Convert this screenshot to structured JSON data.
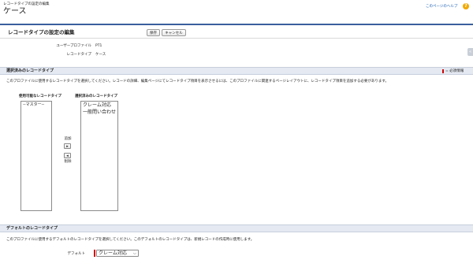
{
  "header": {
    "breadcrumb": "レコードタイプの設定の編集",
    "title": "ケース",
    "help_link": "このページのヘルプ",
    "help_icon": "question-icon"
  },
  "panel": {
    "title": "レコードタイプの設定の編集",
    "save_label": "保存",
    "cancel_label": "キャンセル",
    "profile_label": "ユーザープロファイル",
    "profile_value": "PT1",
    "record_type_label": "レコードタイプ",
    "record_type_value": "ケース"
  },
  "selected_section": {
    "title": "選択済みのレコードタイプ",
    "required_info": "= 必須情報",
    "description": "このプロファイルに使用するレコードタイプを選択してください。レコードの詳細、編集ページにてレコードタイプ項目を表示させるには、このプロファイルに関連するページレイアウトに、レコードタイプ項目を追加する必要があります。",
    "available_label": "使用可能なレコードタイプ",
    "selected_label": "選択済みのレコードタイプ",
    "available_items": [
      "--マスター--"
    ],
    "selected_items": [
      "クレーム対応",
      "一般問い合わせ"
    ],
    "add_label": "追加",
    "remove_label": "削除"
  },
  "default_section": {
    "title": "デフォルトのレコードタイプ",
    "description": "このプロファイルに使用するデフォルトのレコードタイプを選択してください。このデフォルトのレコードタイプは、新規レコードの作成時に使用します。",
    "default_label": "デフォルト",
    "default_value": "クレーム対応"
  },
  "colors": {
    "accent": "#f0a800",
    "required": "#cc0000",
    "section_bg": "#e4e9f2"
  }
}
